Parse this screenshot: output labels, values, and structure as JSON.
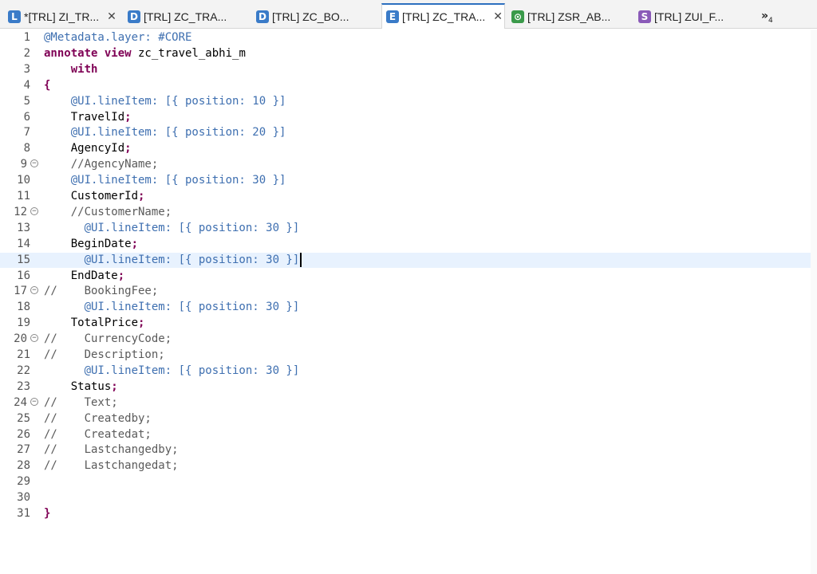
{
  "tabs": [
    {
      "label": "*[TRL] ZI_TR...",
      "icon": "L",
      "icon_name": "ddl-view-icon",
      "icon_color": "#3a7bc8",
      "closable": true,
      "active": false
    },
    {
      "label": "[TRL] ZC_TRA...",
      "icon": "D",
      "icon_name": "data-definition-icon",
      "icon_color": "#3a7bc8",
      "closable": false,
      "active": false
    },
    {
      "label": "[TRL] ZC_BO...",
      "icon": "D",
      "icon_name": "data-definition-icon",
      "icon_color": "#3a7bc8",
      "closable": false,
      "active": false
    },
    {
      "label": "[TRL] ZC_TRA...",
      "icon": "E",
      "icon_name": "metadata-extension-icon",
      "icon_color": "#3a7bc8",
      "closable": true,
      "active": true
    },
    {
      "label": "[TRL] ZSR_AB...",
      "icon": "⊙",
      "icon_name": "service-definition-icon",
      "icon_color": "#3a9a4a",
      "closable": false,
      "active": false
    },
    {
      "label": "[TRL] ZUI_F...",
      "icon": "S",
      "icon_name": "service-binding-icon",
      "icon_color": "#8a5ab8",
      "closable": false,
      "active": false
    }
  ],
  "overflow_label": "»",
  "overflow_count": "4",
  "editor": {
    "current_line": 15,
    "lines": [
      {
        "n": "1",
        "fold": false,
        "parts": [
          {
            "t": "@Metadata.layer: #CORE",
            "c": "a"
          }
        ]
      },
      {
        "n": "2",
        "fold": false,
        "parts": [
          {
            "t": "annotate view",
            "c": "k"
          },
          {
            "t": " zc_travel_abhi_m",
            "c": "p"
          }
        ]
      },
      {
        "n": "3",
        "fold": false,
        "parts": [
          {
            "t": "    ",
            "c": "p"
          },
          {
            "t": "with",
            "c": "k"
          }
        ]
      },
      {
        "n": "4",
        "fold": false,
        "parts": [
          {
            "t": "{",
            "c": "k"
          }
        ]
      },
      {
        "n": "5",
        "fold": false,
        "parts": [
          {
            "t": "    @UI.lineItem: [{ position: 10 }]",
            "c": "a"
          }
        ]
      },
      {
        "n": "6",
        "fold": false,
        "parts": [
          {
            "t": "    TravelId",
            "c": "p"
          },
          {
            "t": ";",
            "c": "s"
          }
        ]
      },
      {
        "n": "7",
        "fold": false,
        "parts": [
          {
            "t": "    @UI.lineItem: [{ position: 20 }]",
            "c": "a"
          }
        ]
      },
      {
        "n": "8",
        "fold": false,
        "parts": [
          {
            "t": "    AgencyId",
            "c": "p"
          },
          {
            "t": ";",
            "c": "s"
          }
        ]
      },
      {
        "n": "9",
        "fold": true,
        "parts": [
          {
            "t": "    //AgencyName;",
            "c": "c"
          }
        ]
      },
      {
        "n": "10",
        "fold": false,
        "parts": [
          {
            "t": "    @UI.lineItem: [{ position: 30 }]",
            "c": "a"
          }
        ]
      },
      {
        "n": "11",
        "fold": false,
        "parts": [
          {
            "t": "    CustomerId",
            "c": "p"
          },
          {
            "t": ";",
            "c": "s"
          }
        ]
      },
      {
        "n": "12",
        "fold": true,
        "parts": [
          {
            "t": "    //CustomerName;",
            "c": "c"
          }
        ]
      },
      {
        "n": "13",
        "fold": false,
        "parts": [
          {
            "t": "      @UI.lineItem: [{ position: 30 }]",
            "c": "a"
          }
        ]
      },
      {
        "n": "14",
        "fold": false,
        "parts": [
          {
            "t": "    BeginDate",
            "c": "p"
          },
          {
            "t": ";",
            "c": "s"
          }
        ]
      },
      {
        "n": "15",
        "fold": false,
        "parts": [
          {
            "t": "      @UI.lineItem: [{ position: 30 }]",
            "c": "a"
          }
        ]
      },
      {
        "n": "16",
        "fold": false,
        "parts": [
          {
            "t": "    EndDate",
            "c": "p"
          },
          {
            "t": ";",
            "c": "s"
          }
        ]
      },
      {
        "n": "17",
        "fold": true,
        "parts": [
          {
            "t": "//    BookingFee;",
            "c": "c"
          }
        ]
      },
      {
        "n": "18",
        "fold": false,
        "parts": [
          {
            "t": "      @UI.lineItem: [{ position: 30 }]",
            "c": "a"
          }
        ]
      },
      {
        "n": "19",
        "fold": false,
        "parts": [
          {
            "t": "    TotalPrice",
            "c": "p"
          },
          {
            "t": ";",
            "c": "s"
          }
        ]
      },
      {
        "n": "20",
        "fold": true,
        "parts": [
          {
            "t": "//    CurrencyCode;",
            "c": "c"
          }
        ]
      },
      {
        "n": "21",
        "fold": false,
        "parts": [
          {
            "t": "//    Description;",
            "c": "c"
          }
        ]
      },
      {
        "n": "22",
        "fold": false,
        "parts": [
          {
            "t": "      @UI.lineItem: [{ position: 30 }]",
            "c": "a"
          }
        ]
      },
      {
        "n": "23",
        "fold": false,
        "parts": [
          {
            "t": "    Status",
            "c": "p"
          },
          {
            "t": ";",
            "c": "s"
          }
        ]
      },
      {
        "n": "24",
        "fold": true,
        "parts": [
          {
            "t": "//    Text;",
            "c": "c"
          }
        ]
      },
      {
        "n": "25",
        "fold": false,
        "parts": [
          {
            "t": "//    Createdby;",
            "c": "c"
          }
        ]
      },
      {
        "n": "26",
        "fold": false,
        "parts": [
          {
            "t": "//    Createdat;",
            "c": "c"
          }
        ]
      },
      {
        "n": "27",
        "fold": false,
        "parts": [
          {
            "t": "//    Lastchangedby;",
            "c": "c"
          }
        ]
      },
      {
        "n": "28",
        "fold": false,
        "parts": [
          {
            "t": "//    Lastchangedat;",
            "c": "c"
          }
        ]
      },
      {
        "n": "29",
        "fold": false,
        "parts": []
      },
      {
        "n": "30",
        "fold": false,
        "parts": []
      },
      {
        "n": "31",
        "fold": false,
        "parts": [
          {
            "t": "}",
            "c": "k"
          }
        ]
      }
    ]
  }
}
